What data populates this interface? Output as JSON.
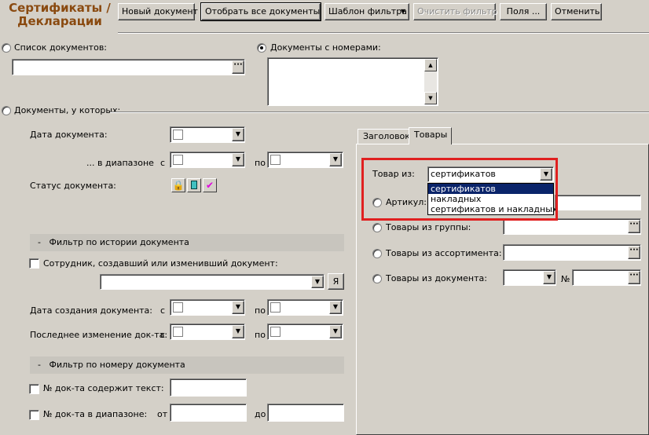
{
  "app": {
    "title_line1": "Сертификаты /",
    "title_line2": "Декларации"
  },
  "toolbar": {
    "new_doc": "Новый документ",
    "show_all": "Отобрать все документы",
    "filter_template": "Шаблон фильтра",
    "clear_filter": "Очистить фильтр",
    "fields": "Поля ...",
    "cancel": "Отменить"
  },
  "left": {
    "doc_list_label": "Список документов:",
    "docs_with_numbers_label": "Документы с номерами:",
    "docs_where_label": "Документы, у которых:",
    "doc_date_label": "Дата документа:",
    "range_label": "... в диапазоне",
    "from": "с",
    "to": "по",
    "status_label": "Статус документа:",
    "history_section": "Фильтр по истории документа",
    "employee_label": "Сотрудник, создавший или изменивший документ:",
    "me_button": "Я",
    "created_date_label": "Дата создания документа:",
    "last_change_label": "Последнее изменение док-та:",
    "number_section": "Фильтр по номеру документа",
    "number_contains_label": "№ док-та содержит текст:",
    "number_range_label": "№ док-та в диапазоне:",
    "range_from": "от",
    "range_to": "до"
  },
  "tabs": {
    "header": "Заголовок",
    "goods": "Товары"
  },
  "goods": {
    "goods_from_label": "Товар из:",
    "goods_from_value": "сертификатов",
    "options": [
      "сертификатов",
      "накладных",
      "сертификатов и накладных"
    ],
    "article_label": "Артикул:",
    "group_label": "Товары из группы:",
    "assortment_label": "Товары из ассортимента:",
    "document_label": "Товары из документа:",
    "number_sign": "№"
  },
  "colors": {
    "highlight": "#e02020",
    "selection": "#0a246a",
    "title": "#8a4a10"
  }
}
